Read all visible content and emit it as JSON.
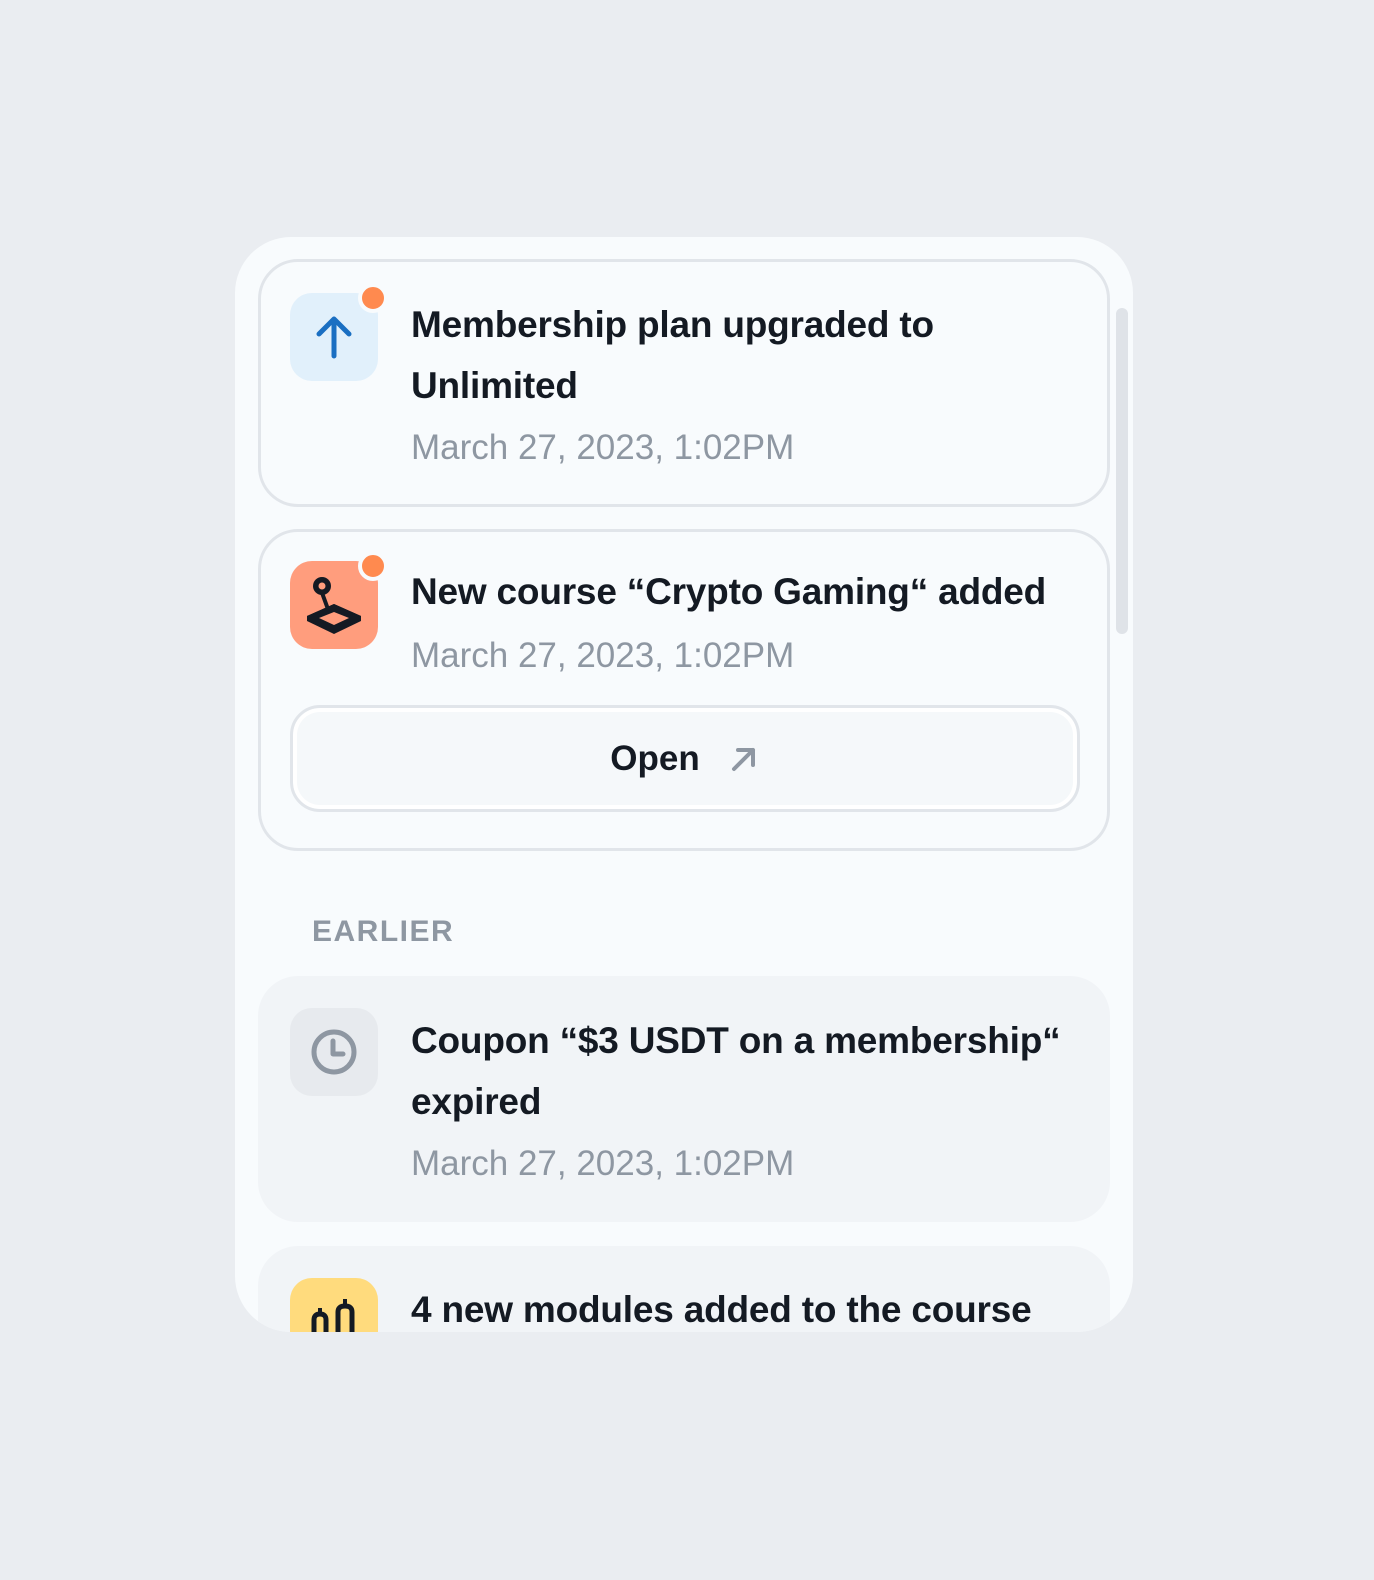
{
  "notifications": [
    {
      "title": "Membership plan upgraded to Unlimited",
      "time": "March 27, 2023, 1:02PM",
      "icon": "arrow-up-icon",
      "icon_bg": "#e1f0fb",
      "icon_color": "#1a6fc2",
      "unread": true
    },
    {
      "title": "New course “Crypto Gaming“ added",
      "time": "March 27, 2023, 1:02PM",
      "icon": "joystick-icon",
      "icon_bg": "#ff9d7d",
      "unread": true,
      "action_label": "Open"
    }
  ],
  "earlier_label": "EARLIER",
  "earlier": [
    {
      "title": "Coupon “$3 USDT on a membership“ expired",
      "time": "March 27, 2023, 1:02PM",
      "icon": "clock-icon",
      "icon_bg": "#e7eaee",
      "icon_color": "#8e97a2"
    },
    {
      "title": "4 new modules added to the course",
      "icon": "modules-icon",
      "icon_bg": "#ffdb7d"
    }
  ],
  "colors": {
    "background": "#eaedf1",
    "panel": "#f8fbfd",
    "unread_dot": "#ff8a4f",
    "text_primary": "#141a23",
    "text_secondary": "#8e97a2"
  }
}
